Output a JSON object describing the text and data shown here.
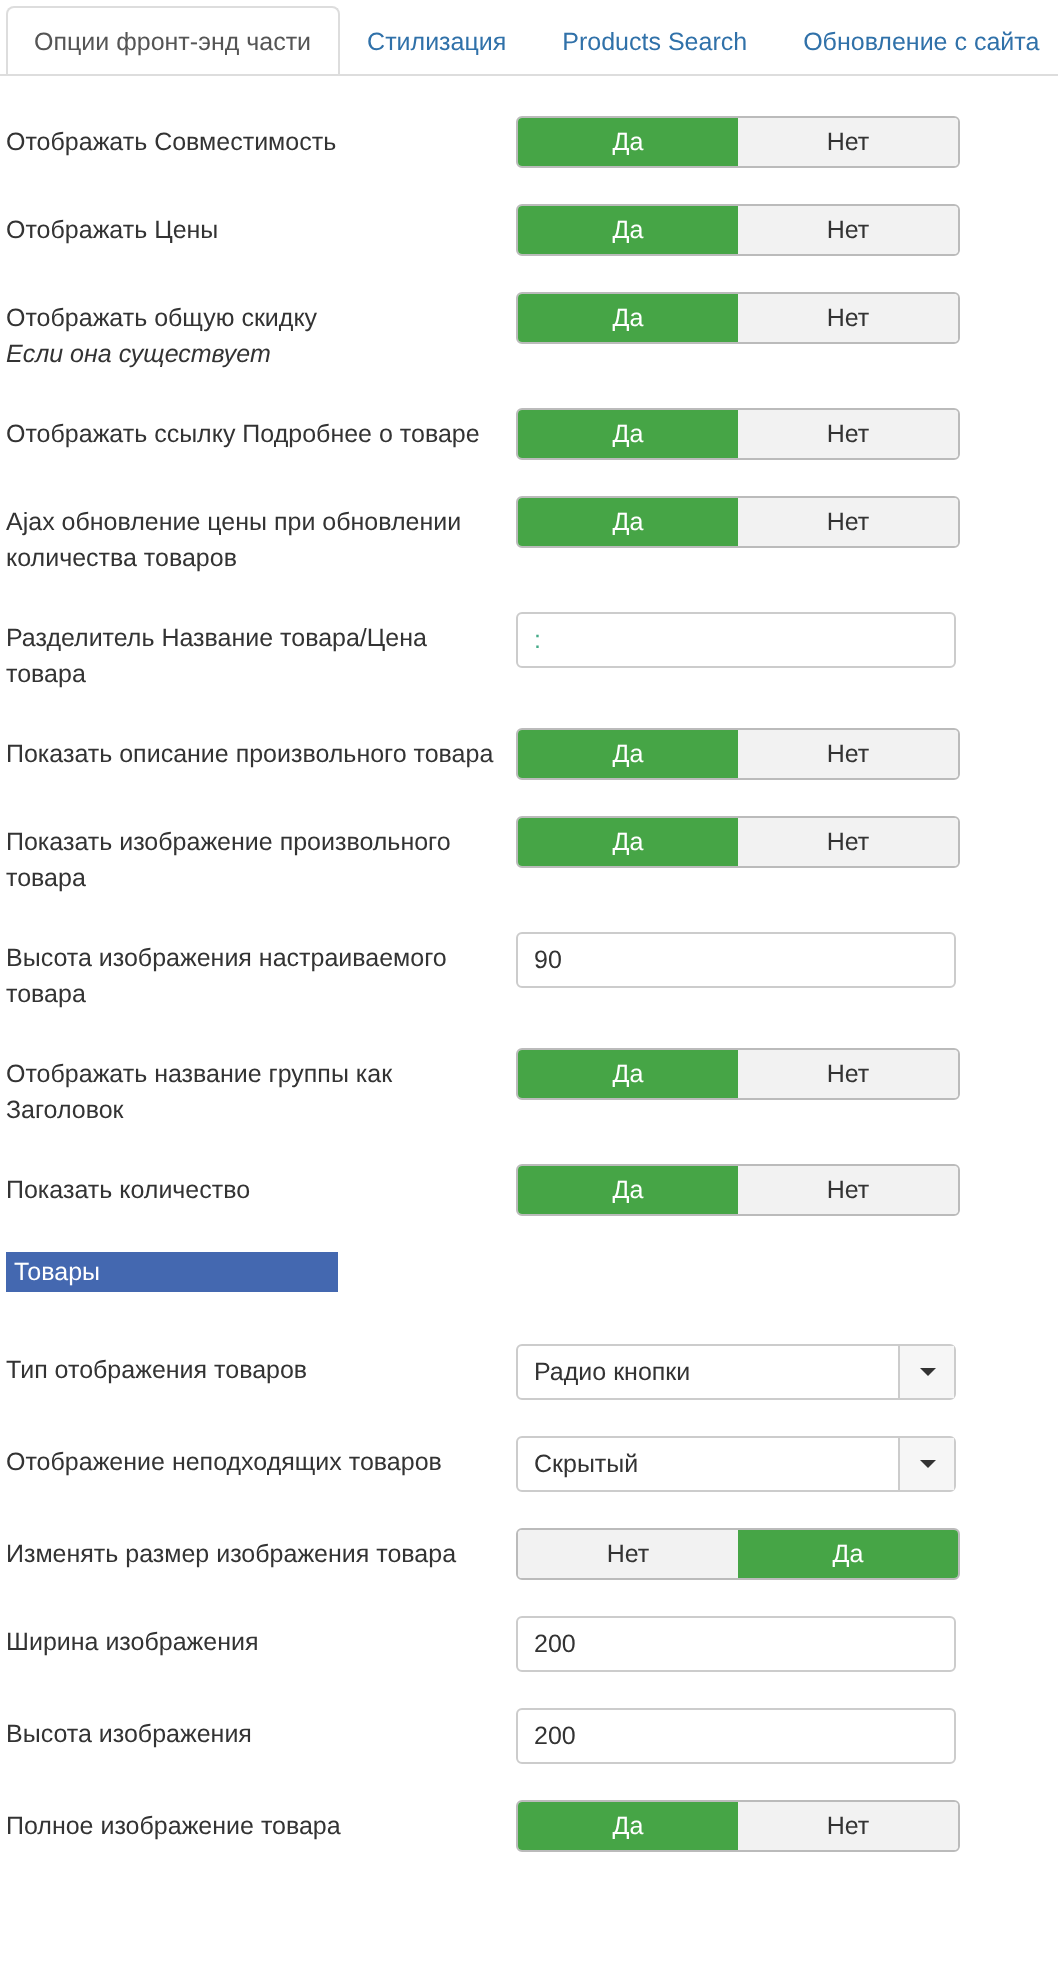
{
  "tabs": [
    {
      "label": "Опции фронт-энд части",
      "selected": true
    },
    {
      "label": "Стилизация",
      "selected": false
    },
    {
      "label": "Products Search",
      "selected": false
    },
    {
      "label": "Обновление с сайта",
      "selected": false
    }
  ],
  "rows": [
    {
      "kind": "toggle",
      "label": "Отображать Совместимость",
      "options": [
        {
          "label": "Да",
          "selected": true
        },
        {
          "label": "Нет",
          "selected": false
        }
      ]
    },
    {
      "kind": "toggle",
      "label": "Отображать Цены",
      "options": [
        {
          "label": "Да",
          "selected": true
        },
        {
          "label": "Нет",
          "selected": false
        }
      ]
    },
    {
      "kind": "toggle",
      "label": "Отображать общую скидку",
      "note": "Если она существует",
      "options": [
        {
          "label": "Да",
          "selected": true
        },
        {
          "label": "Нет",
          "selected": false
        }
      ]
    },
    {
      "kind": "toggle",
      "label": "Отображать ссылку Подробнее о товаре",
      "options": [
        {
          "label": "Да",
          "selected": true
        },
        {
          "label": "Нет",
          "selected": false
        }
      ]
    },
    {
      "kind": "toggle",
      "label": "Ajax обновление цены при обновлении количества товаров",
      "options": [
        {
          "label": "Да",
          "selected": true
        },
        {
          "label": "Нет",
          "selected": false
        }
      ]
    },
    {
      "kind": "text",
      "label": "Разделитель Название товара/Цена товара",
      "placeholder": ":"
    },
    {
      "kind": "toggle",
      "label": "Показать описание произвольного товара",
      "options": [
        {
          "label": "Да",
          "selected": true
        },
        {
          "label": "Нет",
          "selected": false
        }
      ]
    },
    {
      "kind": "toggle",
      "label": "Показать изображение произвольного товара",
      "options": [
        {
          "label": "Да",
          "selected": true
        },
        {
          "label": "Нет",
          "selected": false
        }
      ]
    },
    {
      "kind": "text",
      "label": "Высота изображения настраиваемого товара",
      "value": "90"
    },
    {
      "kind": "toggle",
      "label": "Отображать название группы как Заголовок",
      "options": [
        {
          "label": "Да",
          "selected": true
        },
        {
          "label": "Нет",
          "selected": false
        }
      ]
    },
    {
      "kind": "toggle",
      "label": "Показать количество",
      "options": [
        {
          "label": "Да",
          "selected": true
        },
        {
          "label": "Нет",
          "selected": false
        }
      ]
    },
    {
      "kind": "header",
      "label": "Товары"
    },
    {
      "kind": "select",
      "label": "Тип отображения товаров",
      "value": "Радио кнопки"
    },
    {
      "kind": "select",
      "label": "Отображение неподходящих товаров",
      "value": "Скрытый"
    },
    {
      "kind": "toggle",
      "label": "Изменять размер изображения товара",
      "options": [
        {
          "label": "Нет",
          "selected": false
        },
        {
          "label": "Да",
          "selected": true
        }
      ]
    },
    {
      "kind": "text",
      "label": "Ширина изображения",
      "value": "200"
    },
    {
      "kind": "text",
      "label": "Высота изображения",
      "value": "200"
    },
    {
      "kind": "toggle",
      "label": "Полное изображение товара",
      "options": [
        {
          "label": "Да",
          "selected": true
        },
        {
          "label": "Нет",
          "selected": false
        }
      ]
    }
  ]
}
